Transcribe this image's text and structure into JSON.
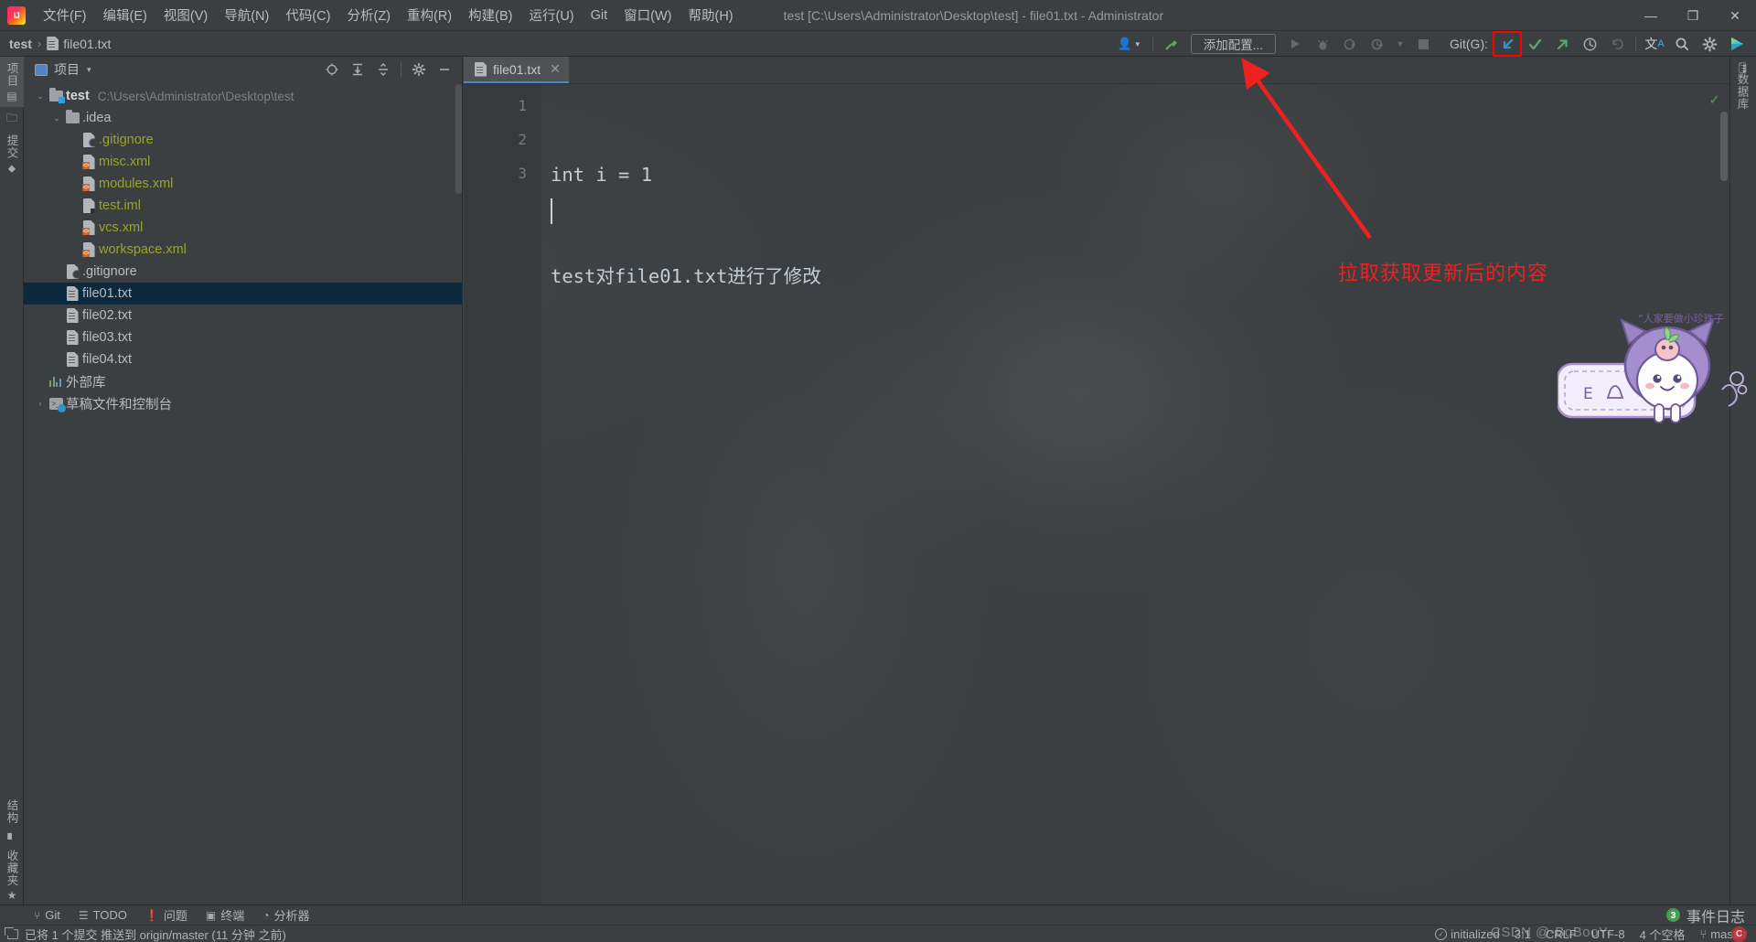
{
  "window": {
    "title": "test [C:\\Users\\Administrator\\Desktop\\test] - file01.txt - Administrator",
    "minimize": "—",
    "maximize": "❐",
    "close": "✕"
  },
  "menubar": {
    "logo": "intellij-idea-logo",
    "items": [
      {
        "label": "文件(F)",
        "name": "menu-file"
      },
      {
        "label": "编辑(E)",
        "name": "menu-edit"
      },
      {
        "label": "视图(V)",
        "name": "menu-view"
      },
      {
        "label": "导航(N)",
        "name": "menu-navigate"
      },
      {
        "label": "代码(C)",
        "name": "menu-code"
      },
      {
        "label": "分析(Z)",
        "name": "menu-analyze"
      },
      {
        "label": "重构(R)",
        "name": "menu-refactor"
      },
      {
        "label": "构建(B)",
        "name": "menu-build"
      },
      {
        "label": "运行(U)",
        "name": "menu-run"
      },
      {
        "label": "Git",
        "name": "menu-git"
      },
      {
        "label": "窗口(W)",
        "name": "menu-window"
      },
      {
        "label": "帮助(H)",
        "name": "menu-help"
      }
    ]
  },
  "breadcrumb": {
    "root": "test",
    "separator": "›",
    "file": "file01.txt"
  },
  "toolbar": {
    "add_config_label": "添加配置...",
    "git_label": "Git(G):",
    "buttons": [
      {
        "name": "user-account-button",
        "glyph": "👤",
        "enabled": true
      },
      {
        "name": "build-hammer-button",
        "glyph": "⚒",
        "enabled": true
      },
      {
        "name": "run-button",
        "glyph": "▶",
        "enabled": false
      },
      {
        "name": "debug-button",
        "glyph": "🐞",
        "enabled": false
      },
      {
        "name": "run-with-coverage-button",
        "glyph": "◑",
        "enabled": false
      },
      {
        "name": "profile-button",
        "glyph": "◴",
        "enabled": false
      },
      {
        "name": "run-dropdown-button",
        "glyph": "▾",
        "enabled": false
      },
      {
        "name": "stop-button",
        "glyph": "■",
        "enabled": false
      }
    ],
    "git_buttons": [
      {
        "name": "git-pull-button",
        "glyph": "↙",
        "color": "#3592c4",
        "highlighted": true
      },
      {
        "name": "git-commit-button",
        "glyph": "✓",
        "color": "#59a869",
        "highlighted": false
      },
      {
        "name": "git-push-button",
        "glyph": "↗",
        "color": "#59a869",
        "highlighted": false
      },
      {
        "name": "git-history-button",
        "glyph": "◴",
        "color": "#a6a9ab",
        "highlighted": false
      },
      {
        "name": "git-rollback-button",
        "glyph": "↶",
        "color": "#707375",
        "highlighted": false
      }
    ],
    "right_buttons": [
      {
        "name": "translate-button",
        "glyph": "文A",
        "color": "#a6c8e0"
      },
      {
        "name": "search-everywhere-button",
        "glyph": "⌕",
        "color": "#a6a9ab"
      },
      {
        "name": "settings-gear-button",
        "glyph": "⚙",
        "color": "#a6a9ab"
      },
      {
        "name": "ide-play-button",
        "glyph": "▶",
        "color": "#4ec9d8"
      }
    ]
  },
  "left_strip": {
    "top_tabs": [
      {
        "name": "sidebar-tab-project",
        "label": "项目",
        "icon": "project-icon",
        "selected": true
      },
      {
        "name": "sidebar-tab-folder",
        "label": "",
        "icon": "folder-icon",
        "selected": false
      },
      {
        "name": "sidebar-tab-commit",
        "label": "提交",
        "icon": "commit-icon",
        "selected": false
      }
    ],
    "bottom_tabs": [
      {
        "name": "sidebar-tab-structure",
        "label": "结构",
        "icon": "structure-icon"
      },
      {
        "name": "sidebar-tab-favorites",
        "label": "收藏夹",
        "icon": "star-icon"
      }
    ]
  },
  "right_strip": {
    "tabs": [
      {
        "name": "sidebar-tab-database",
        "label": "数据库",
        "icon": "database-icon"
      }
    ]
  },
  "project_panel": {
    "title": "项目",
    "chevron": "▾",
    "tools": [
      {
        "name": "select-opened-file-icon",
        "glyph": "⊕"
      },
      {
        "name": "expand-all-icon",
        "glyph": "⤓"
      },
      {
        "name": "collapse-all-icon",
        "glyph": "⤒"
      },
      {
        "name": "panel-settings-gear-icon",
        "glyph": "⚙"
      },
      {
        "name": "hide-panel-icon",
        "glyph": "—"
      }
    ],
    "tree": [
      {
        "name": "tree-node-test",
        "label": "test",
        "suffix": "C:\\Users\\Administrator\\Desktop\\test",
        "icon": "folder-module-icon",
        "indent": 0,
        "chevron": "⌄",
        "style": "bold",
        "selected": false
      },
      {
        "name": "tree-node-idea",
        "label": ".idea",
        "suffix": "",
        "icon": "folder-icon",
        "indent": 1,
        "chevron": "⌄",
        "style": "normal",
        "selected": false
      },
      {
        "name": "tree-node-gitignore-idea",
        "label": ".gitignore",
        "suffix": "",
        "icon": "ignored-file-icon",
        "indent": 2,
        "chevron": "",
        "style": "olive",
        "selected": false
      },
      {
        "name": "tree-node-misc-xml",
        "label": "misc.xml",
        "suffix": "",
        "icon": "xml-file-icon",
        "indent": 2,
        "chevron": "",
        "style": "olive",
        "selected": false
      },
      {
        "name": "tree-node-modules-xml",
        "label": "modules.xml",
        "suffix": "",
        "icon": "xml-file-icon",
        "indent": 2,
        "chevron": "",
        "style": "olive",
        "selected": false
      },
      {
        "name": "tree-node-test-iml",
        "label": "test.iml",
        "suffix": "",
        "icon": "iml-file-icon",
        "indent": 2,
        "chevron": "",
        "style": "olive",
        "selected": false
      },
      {
        "name": "tree-node-vcs-xml",
        "label": "vcs.xml",
        "suffix": "",
        "icon": "xml-file-icon",
        "indent": 2,
        "chevron": "",
        "style": "olive",
        "selected": false
      },
      {
        "name": "tree-node-workspace-xml",
        "label": "workspace.xml",
        "suffix": "",
        "icon": "xml-file-icon",
        "indent": 2,
        "chevron": "",
        "style": "olive",
        "selected": false
      },
      {
        "name": "tree-node-gitignore-root",
        "label": ".gitignore",
        "suffix": "",
        "icon": "ignored-file-icon",
        "indent": 1,
        "chevron": "",
        "style": "normal",
        "selected": false
      },
      {
        "name": "tree-node-file01",
        "label": "file01.txt",
        "suffix": "",
        "icon": "text-file-icon",
        "indent": 1,
        "chevron": "",
        "style": "normal",
        "selected": true
      },
      {
        "name": "tree-node-file02",
        "label": "file02.txt",
        "suffix": "",
        "icon": "text-file-icon",
        "indent": 1,
        "chevron": "",
        "style": "normal",
        "selected": false
      },
      {
        "name": "tree-node-file03",
        "label": "file03.txt",
        "suffix": "",
        "icon": "text-file-icon",
        "indent": 1,
        "chevron": "",
        "style": "normal",
        "selected": false
      },
      {
        "name": "tree-node-file04",
        "label": "file04.txt",
        "suffix": "",
        "icon": "text-file-icon",
        "indent": 1,
        "chevron": "",
        "style": "normal",
        "selected": false
      },
      {
        "name": "tree-node-external-libraries",
        "label": "外部库",
        "suffix": "",
        "icon": "library-icon",
        "indent": 0,
        "chevron": "",
        "style": "normal",
        "selected": false
      },
      {
        "name": "tree-node-scratches",
        "label": "草稿文件和控制台",
        "suffix": "",
        "icon": "scratch-icon",
        "indent": 0,
        "chevron": "›",
        "style": "normal",
        "selected": false
      }
    ]
  },
  "editor": {
    "tabs": [
      {
        "name": "editor-tab-file01",
        "label": "file01.txt",
        "close": "✕",
        "active": true
      }
    ],
    "line_numbers": [
      "1",
      "2",
      "3"
    ],
    "lines": [
      "int i = 1",
      "test对file01.txt进行了修改",
      ""
    ],
    "inspection_status": "✓"
  },
  "annotation": {
    "text": "拉取获取更新后的内容",
    "color": "#ef2020"
  },
  "sticker": {
    "caption": "人家要做小珍珠子",
    "name": "kuromi-sticker"
  },
  "toolwindow_bar": {
    "items": [
      {
        "name": "toolwindow-git",
        "label": "Git",
        "icon": "git-branch-icon"
      },
      {
        "name": "toolwindow-todo",
        "label": "TODO",
        "icon": "todo-list-icon"
      },
      {
        "name": "toolwindow-problems",
        "label": "问题",
        "icon": "problems-icon"
      },
      {
        "name": "toolwindow-terminal",
        "label": "终端",
        "icon": "terminal-icon"
      },
      {
        "name": "toolwindow-profiler",
        "label": "分析器",
        "icon": "profiler-icon"
      }
    ],
    "event_log": {
      "label": "事件日志",
      "count": "3"
    }
  },
  "statusbar": {
    "message": "已将 1 个提交 推送到 origin/master (11 分钟 之前)",
    "right": [
      {
        "name": "status-git-initialized",
        "label": "initialized",
        "icon": "check-circle-icon"
      },
      {
        "name": "status-caret-position",
        "label": "3:1",
        "icon": ""
      },
      {
        "name": "status-line-separator",
        "label": "CRLF",
        "icon": ""
      },
      {
        "name": "status-encoding",
        "label": "UTF-8",
        "icon": ""
      },
      {
        "name": "status-indent",
        "label": "4 个空格",
        "icon": ""
      },
      {
        "name": "status-branch",
        "label": "master",
        "icon": "branch-icon"
      }
    ]
  },
  "watermark": {
    "text": "CSDN @-BoBooY-"
  }
}
